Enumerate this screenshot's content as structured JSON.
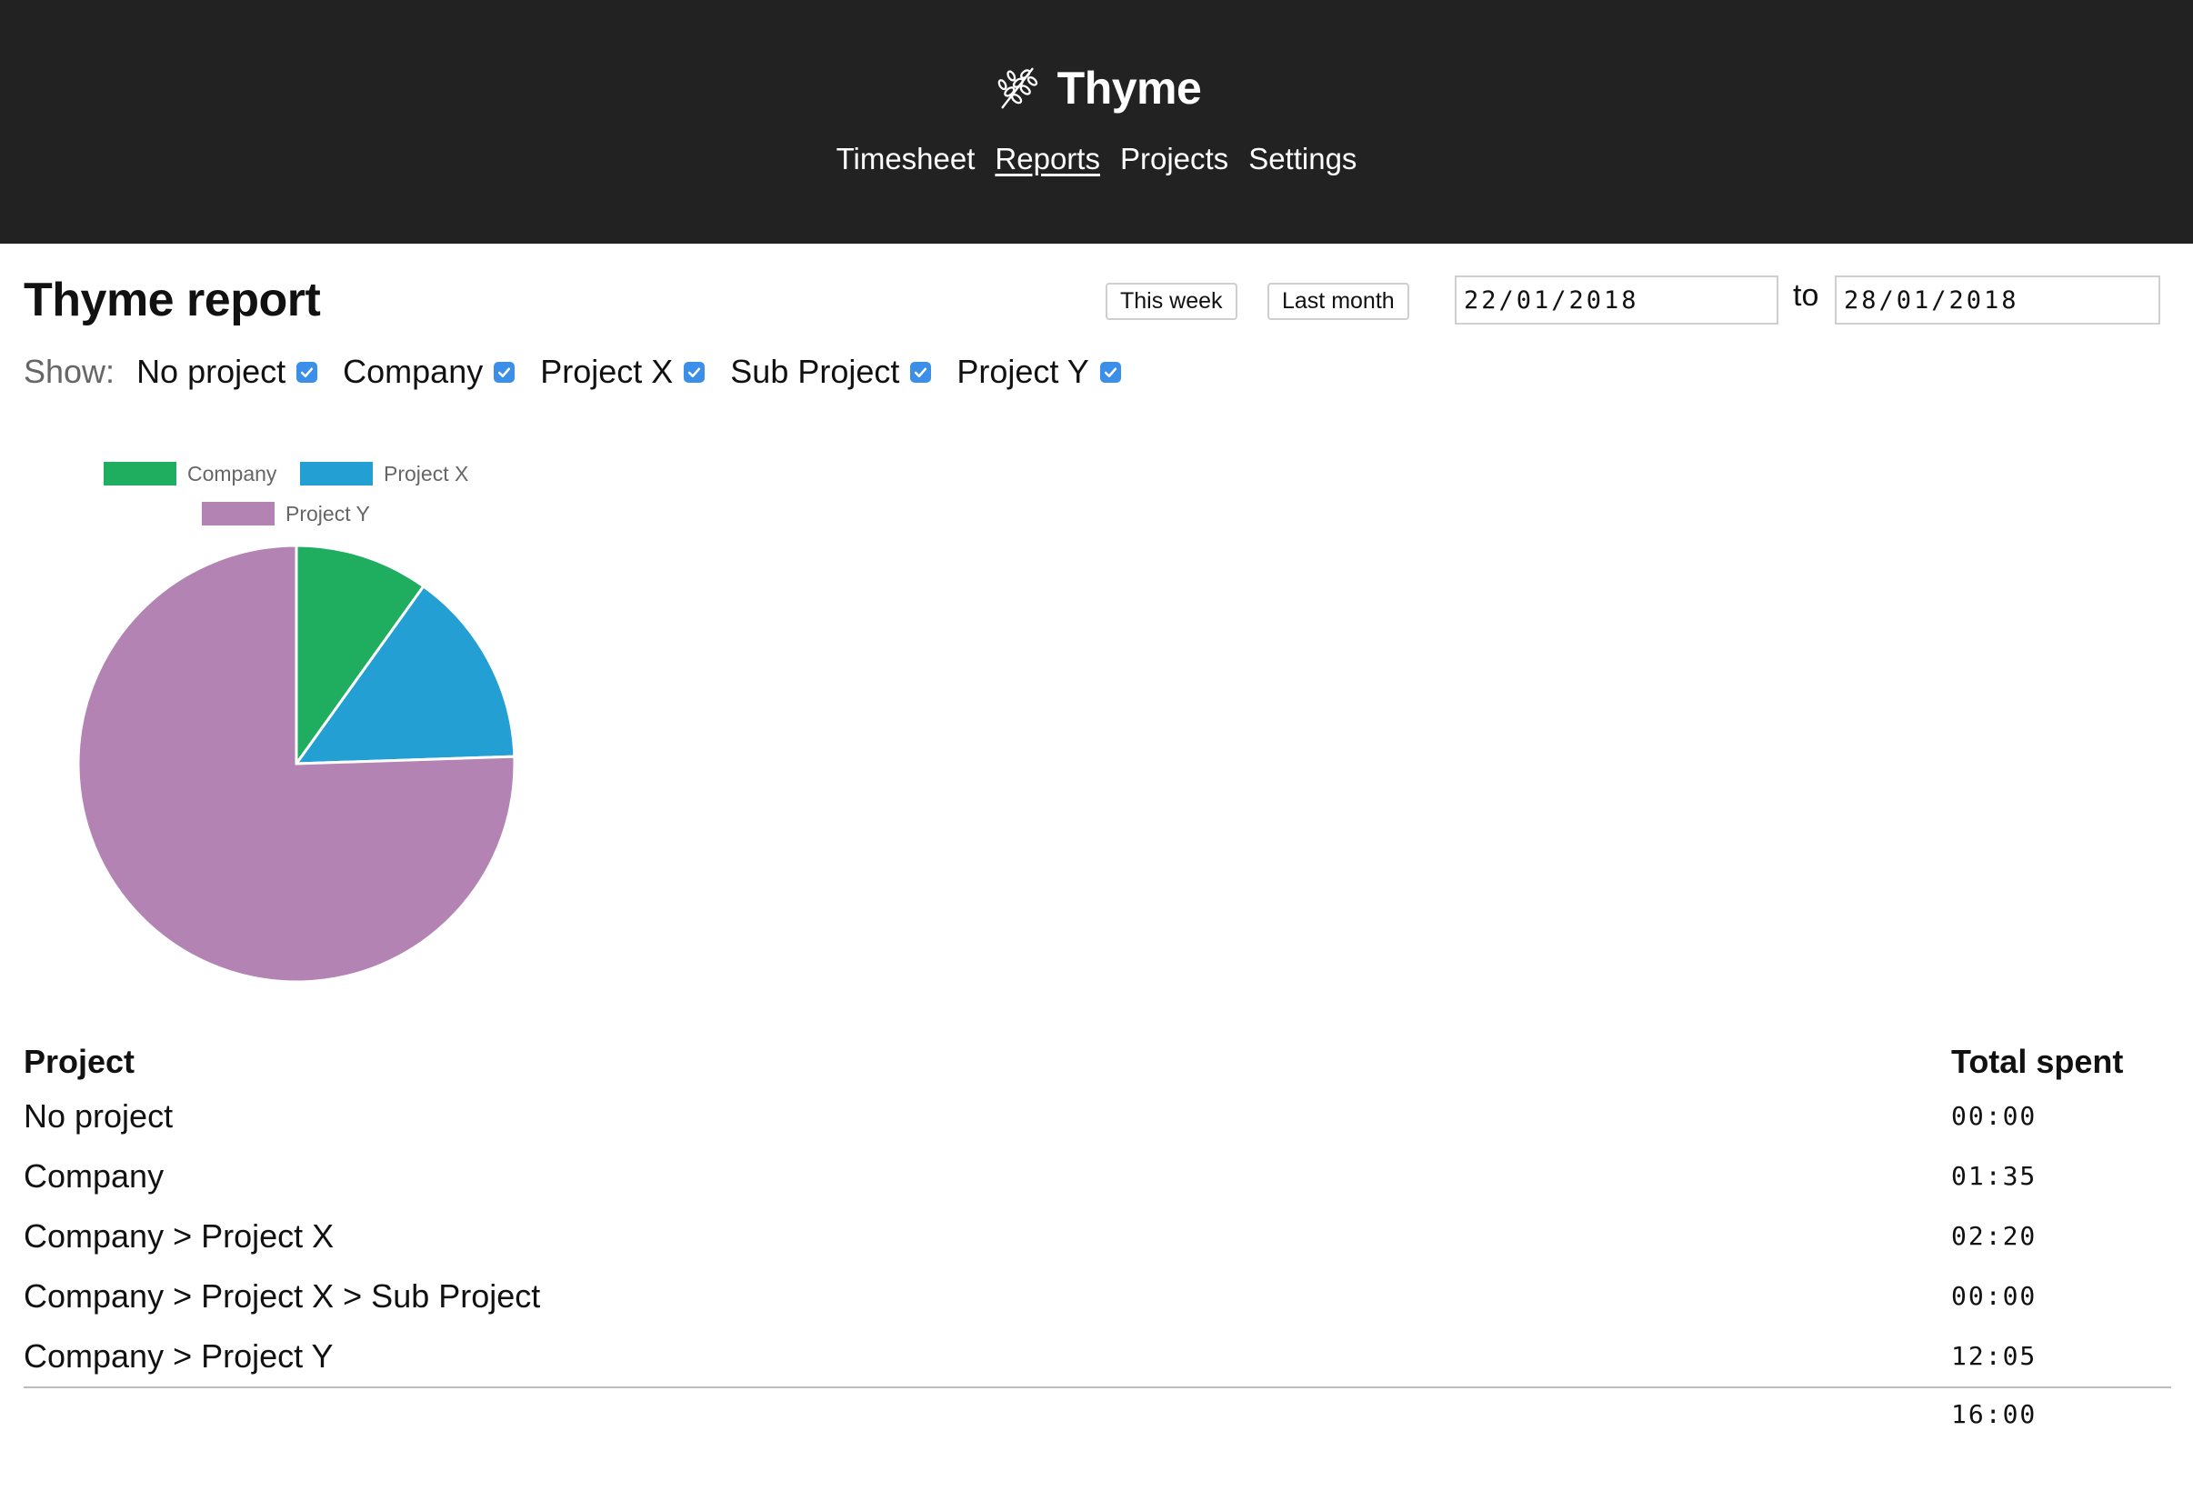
{
  "app": {
    "name": "Thyme",
    "nav": [
      {
        "label": "Timesheet",
        "active": false
      },
      {
        "label": "Reports",
        "active": true
      },
      {
        "label": "Projects",
        "active": false
      },
      {
        "label": "Settings",
        "active": false
      }
    ]
  },
  "report": {
    "title": "Thyme report",
    "quick_ranges": [
      "This week",
      "Last month"
    ],
    "date_from": "22/01/2018",
    "date_to": "28/01/2018",
    "to_label": "to",
    "show_label": "Show:",
    "filters": [
      {
        "label": "No project",
        "checked": true
      },
      {
        "label": "Company",
        "checked": true
      },
      {
        "label": "Project X",
        "checked": true
      },
      {
        "label": "Sub Project",
        "checked": true
      },
      {
        "label": "Project Y",
        "checked": true
      }
    ]
  },
  "table": {
    "headers": {
      "project": "Project",
      "total": "Total spent"
    },
    "rows": [
      {
        "project": "No project",
        "total": "00:00"
      },
      {
        "project": "Company",
        "total": "01:35"
      },
      {
        "project": "Company > Project X",
        "total": "02:20"
      },
      {
        "project": "Company > Project X > Sub Project",
        "total": "00:00"
      },
      {
        "project": "Company > Project Y",
        "total": "12:05"
      }
    ],
    "grand_total": "16:00"
  },
  "chart_data": {
    "type": "pie",
    "legend_position": "top",
    "labels": [
      "Company",
      "Project X",
      "Project Y"
    ],
    "values": [
      95,
      140,
      725
    ],
    "unit": "minutes",
    "colors": [
      "#1fae5f",
      "#239fd4",
      "#b383b3"
    ]
  },
  "colors": {
    "header_bg": "#222222",
    "checkbox": "#3b8fe8"
  },
  "icons": {
    "brand": "thyme-sprig-icon",
    "checkbox": "checkmark-icon"
  }
}
